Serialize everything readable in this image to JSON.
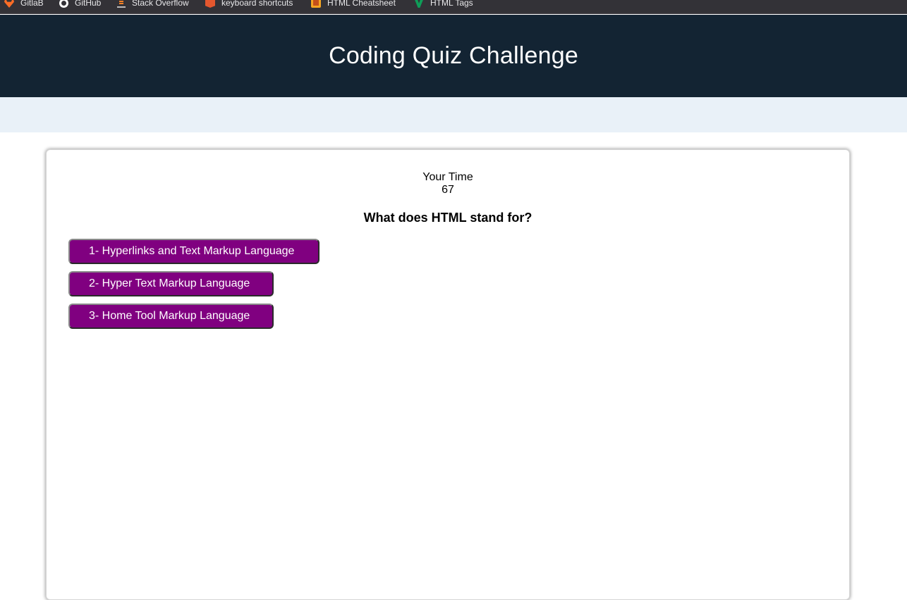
{
  "bookmarks": [
    {
      "label": "GitlaB",
      "icon": "gitlab-icon"
    },
    {
      "label": "GitHub",
      "icon": "github-icon"
    },
    {
      "label": "Stack Overflow",
      "icon": "stack-overflow-icon"
    },
    {
      "label": "keyboard shortcuts",
      "icon": "keyboard-shortcuts-icon"
    },
    {
      "label": "HTML Cheatsheet",
      "icon": "html-cheatsheet-icon"
    },
    {
      "label": "HTML Tags",
      "icon": "html-tags-icon"
    }
  ],
  "header": {
    "title": "Coding Quiz Challenge"
  },
  "quiz": {
    "timer_label": "Your Time",
    "timer_value": "67",
    "question": "What does HTML stand for?",
    "answers": [
      "1- Hyperlinks and Text Markup Language",
      "2- Hyper Text Markup Language",
      "3- Home Tool Markup Language"
    ]
  },
  "colors": {
    "header_bg": "#132433",
    "subbar_bg": "#e9f1f8",
    "answer_bg": "#800080",
    "bookmarks_bg": "#333237"
  }
}
